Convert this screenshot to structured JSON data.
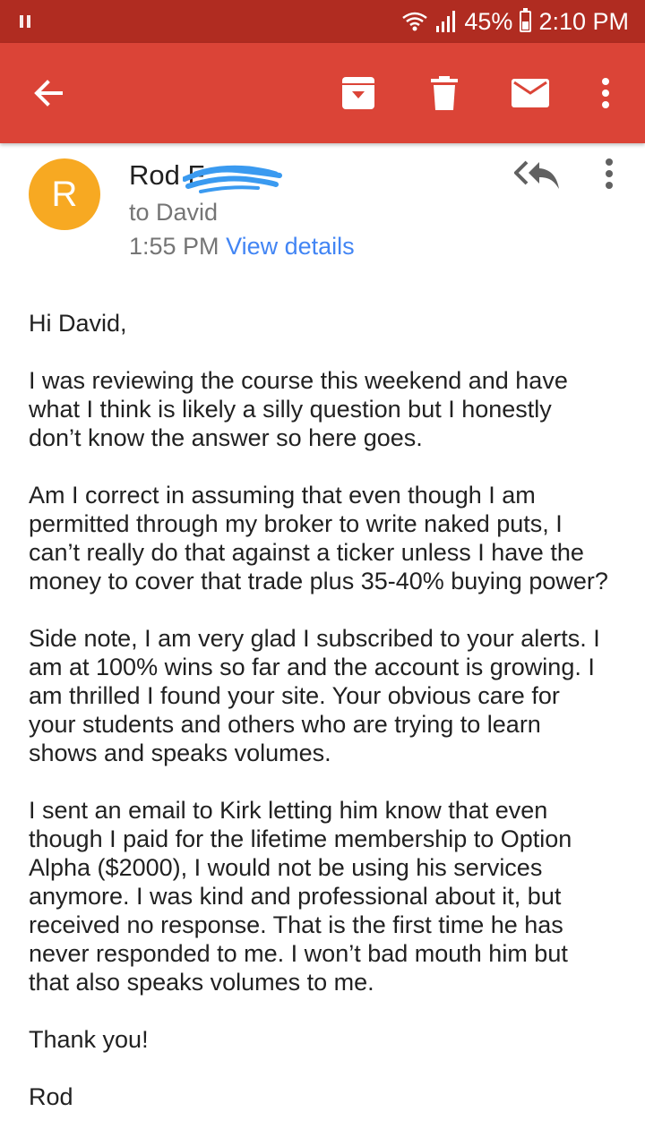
{
  "status_bar": {
    "battery": "45%",
    "time": "2:10 PM",
    "icons": [
      "pause-icon",
      "wifi-icon",
      "signal-icon",
      "battery-icon"
    ]
  },
  "app_bar": {
    "color": "#db4437",
    "actions": [
      "back-arrow-icon",
      "archive-icon",
      "delete-icon",
      "mark-unread-icon",
      "more-vert-icon"
    ]
  },
  "email": {
    "avatar_letter": "R",
    "avatar_color": "#f7a922",
    "sender_name": "Rod F",
    "recipient": "to David",
    "time": "1:55 PM",
    "view_details": "View details",
    "paragraphs": [
      "Hi David,",
      "I was reviewing the course this weekend and have\nwhat I think is likely a silly question but I honestly\ndon’t know the answer so here goes.",
      "Am I correct in assuming that even though I am\npermitted through my broker to write naked puts, I\ncan’t really do that against a ticker unless I have the\nmoney to cover that trade plus 35-40% buying power?",
      "Side note, I am very glad I subscribed to your alerts. I\nam at 100% wins so far and the account is growing. I\nam thrilled I found your site. Your obvious care for\nyour students and others who are trying to learn\nshows and speaks volumes.",
      "I sent an email to Kirk letting him know that even\nthough I paid for the lifetime membership to Option\nAlpha ($2000), I would not be using his services\nanymore. I was kind and professional about it, but\nreceived no response. That is the first time he has\nnever responded to me. I won’t bad mouth him but\nthat also speaks volumes to me.",
      "Thank you!",
      "Rod"
    ]
  }
}
